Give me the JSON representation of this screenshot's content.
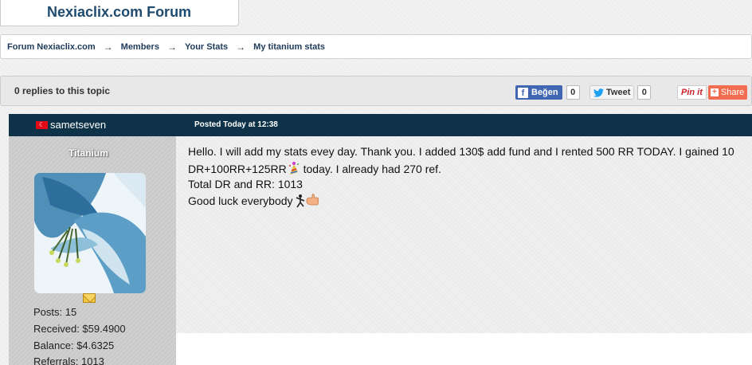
{
  "site": {
    "title": "Nexiaclix.com Forum"
  },
  "breadcrumb": {
    "items": [
      "Forum Nexiaclix.com",
      "Members",
      "Your Stats",
      "My titanium stats"
    ],
    "separator": "→"
  },
  "topic": {
    "replies_label": "0 replies to this topic",
    "social": {
      "facebook_label": "Beğen",
      "facebook_icon": "f",
      "facebook_count": "0",
      "tweet_label": "Tweet",
      "tweet_count": "0",
      "pinterest_label": "Pin it",
      "share_label": "Share"
    }
  },
  "post": {
    "author": "sametseven",
    "flag_icon": "turkey-flag-icon",
    "posted": "Posted Today at 12:38",
    "rank": "Titanium",
    "stats": {
      "posts": "Posts: 15",
      "received": "Received: $59.4900",
      "balance": "Balance: $4.6325",
      "referrals": "Referrals: 1013"
    },
    "body": {
      "line1": "Hello. I will add my stats evey day. Thank you. I added 130$ add fund and I rented 500 RR TODAY. I gained 10",
      "line2_before": "DR+100RR+125RR",
      "line2_after": " today. I already had 270 ref.",
      "line3": "Total DR and RR: 1013",
      "line4": "Good luck everybody "
    }
  },
  "colors": {
    "header_bg": "#0e3349",
    "title_color": "#1e4a6e",
    "facebook": "#4267b2",
    "share": "#f26d4f",
    "pinterest": "#cb2027",
    "flag": "#e30a17"
  }
}
